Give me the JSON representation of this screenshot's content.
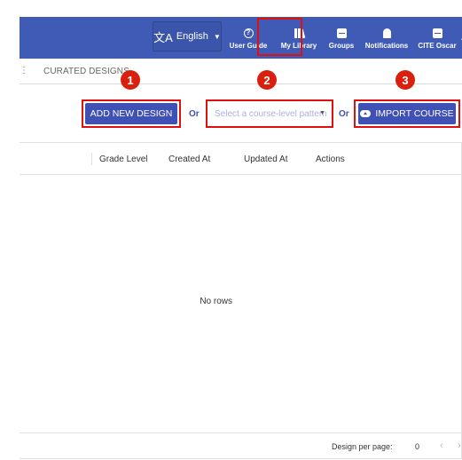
{
  "topbar": {
    "language": {
      "label": "English",
      "glyph": "文A"
    },
    "nav": [
      {
        "label": "User Guide",
        "icon": "help-circle-icon"
      },
      {
        "label": "My Library",
        "icon": "library-icon"
      },
      {
        "label": "Groups",
        "icon": "groups-icon"
      },
      {
        "label": "Notifications",
        "icon": "bell-icon"
      },
      {
        "label": "CITE Oscar",
        "icon": "account-icon"
      }
    ],
    "bg_color": "#3f5bb5"
  },
  "tabs": {
    "curated": "CURATED DESIGNS"
  },
  "badges": [
    "1",
    "2",
    "3"
  ],
  "actions": {
    "add_design": "ADD NEW DESIGN",
    "or": "Or",
    "pattern_placeholder": "Select a course-level pattern",
    "import_course": "IMPORT COURSE"
  },
  "table": {
    "columns": [
      "Grade Level",
      "Created At",
      "Updated At",
      "Actions"
    ],
    "empty_text": "No rows",
    "per_page_label": "Design per page:",
    "per_page_value": "0"
  },
  "highlight_color": "#e01010",
  "button_color": "#3f51b5"
}
